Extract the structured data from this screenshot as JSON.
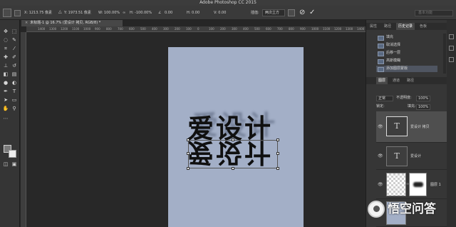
{
  "app": {
    "title": "Adobe Photoshop CC 2015"
  },
  "options": {
    "x": "X: 1213.75 像素",
    "y": "Y: 1973.51 像素",
    "w": "W: 100.00%",
    "h": "H: -100.00%",
    "angle": "0.00",
    "hskew": "H: 0.00",
    "vskew": "V: 0.00",
    "interp_label": "插值:",
    "interp_value": "两次立方",
    "workspace": "基本功能"
  },
  "document": {
    "tab": "未标题-1 @ 16.7% (爱设计 拷贝, RGB/8) *"
  },
  "ruler_ticks": [
    "1400",
    "1300",
    "1200",
    "1100",
    "1000",
    "900",
    "800",
    "700",
    "600",
    "500",
    "400",
    "300",
    "200",
    "100",
    "0",
    "100",
    "200",
    "300",
    "400",
    "500",
    "600",
    "700",
    "800",
    "900",
    "1000",
    "1100",
    "1200",
    "1300",
    "1400",
    "1500"
  ],
  "canvas": {
    "artwork_text": "爱设计"
  },
  "panel_tabs_top": [
    "属性",
    "路径",
    "历史记录",
    "色板"
  ],
  "history": [
    "填充",
    "取消选择",
    "后移一层",
    "高斯模糊",
    "添加图层蒙版"
  ],
  "panel_tabs_layers": [
    "图层",
    "通道",
    "路径"
  ],
  "layers_controls": {
    "blend_mode": "正常",
    "opacity_label": "不透明度:",
    "opacity_value": "100%",
    "lock_label": "锁定:",
    "fill_label": "填充:",
    "fill_value": "100%"
  },
  "layers": [
    {
      "name": "爱设计 拷贝",
      "thumb": "T",
      "selected": true
    },
    {
      "name": "爱设计",
      "thumb": "T",
      "selected": false
    },
    {
      "name": "图层 1",
      "thumb": "",
      "selected": false
    }
  ],
  "watermark": {
    "text": "悟空问答"
  }
}
